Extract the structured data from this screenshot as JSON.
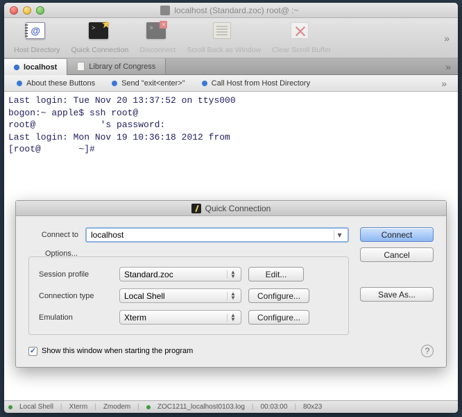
{
  "window": {
    "title": "localhost (Standard.zoc) root@         :~"
  },
  "toolbar": {
    "host_directory": "Host Directory",
    "quick_connection": "Quick Connection",
    "disconnect": "Disconnect",
    "scroll_back": "Scroll Back as Window",
    "clear_scroll": "Clear Scroll Buffer"
  },
  "tabs": {
    "active": "localhost",
    "other": "Library of Congress"
  },
  "buttonbar": {
    "about": "About these Buttons",
    "send_exit": "Send \"exit<enter>\"",
    "call_host": "Call Host from Host Directory"
  },
  "terminal": {
    "lines": "Last login: Tue Nov 20 13:37:52 on ttys000\nbogon:~ apple$ ssh root@\nroot@            's password:\nLast login: Mon Nov 19 10:36:18 2012 from\n[root@       ~]#"
  },
  "dialog": {
    "title": "Quick Connection",
    "connect_to_label": "Connect to",
    "connect_to_value": "localhost",
    "options_label": "Options...",
    "session_profile_label": "Session profile",
    "session_profile_value": "Standard.zoc",
    "connection_type_label": "Connection type",
    "connection_type_value": "Local Shell",
    "emulation_label": "Emulation",
    "emulation_value": "Xterm",
    "edit_label": "Edit...",
    "configure_label": "Configure...",
    "connect_btn": "Connect",
    "cancel_btn": "Cancel",
    "save_as_btn": "Save As...",
    "show_window_label": "Show this window when starting the program"
  },
  "statusbar": {
    "s1": "Local Shell",
    "s2": "Xterm",
    "s3": "Zmodem",
    "s4": "ZOC1211_localhost0103.log",
    "s5": "00:03:00",
    "s6": "80x23"
  }
}
